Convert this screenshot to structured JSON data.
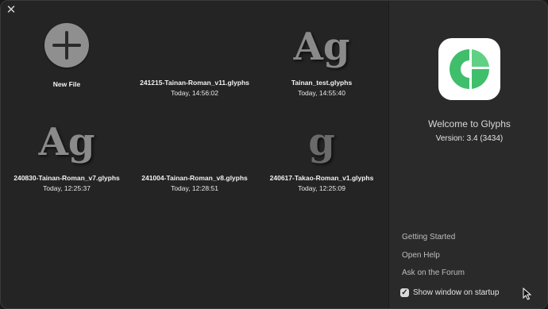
{
  "window": {
    "close_icon": "close-icon"
  },
  "documents": [
    {
      "kind": "new",
      "name": "New File",
      "date": ""
    },
    {
      "kind": "file",
      "icon_text": "",
      "name": "241215-Tainan-Roman_v11.glyphs",
      "date": "Today, 14:56:02"
    },
    {
      "kind": "file",
      "icon_text": "Ag",
      "name": "Tainan_test.glyphs",
      "date": "Today, 14:55:40"
    },
    {
      "kind": "file",
      "icon_text": "Ag",
      "name": "240830-Tainan-Roman_v7.glyphs",
      "date": "Today, 12:25:37"
    },
    {
      "kind": "file",
      "icon_text": "",
      "name": "241004-Tainan-Roman_v8.glyphs",
      "date": "Today, 12:28:51"
    },
    {
      "kind": "file",
      "icon_text": "g",
      "name": "240617-Takao-Roman_v1.glyphs",
      "date": "Today, 12:25:09"
    }
  ],
  "sidebar": {
    "title": "Welcome to Glyphs",
    "version": "Version: 3.4 (3434)",
    "links": [
      "Getting Started",
      "Open Help",
      "Ask on the Forum"
    ],
    "show_on_startup_label": "Show window on startup",
    "show_on_startup_checked": true
  },
  "colors": {
    "app_icon_green": "#3fbf6b",
    "app_icon_green_light": "#5fd184"
  }
}
